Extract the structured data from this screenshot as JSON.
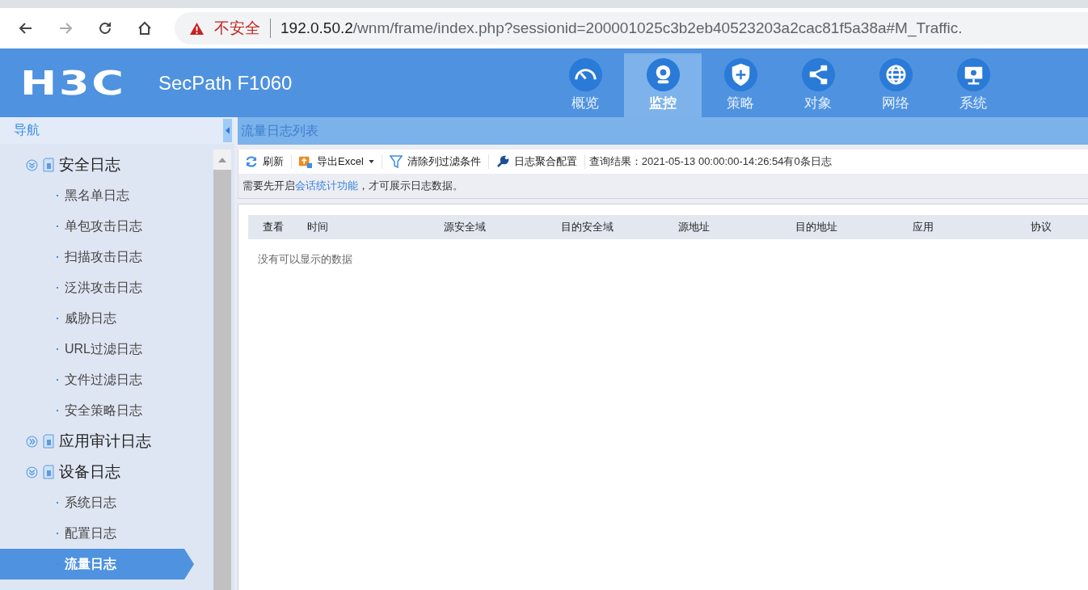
{
  "browser": {
    "security_label": "不安全",
    "url_host": "192.0.50.2",
    "url_path": "/wnm/frame/index.php?sessionid=200001025c3b2eb40523203a2cac81f5a38a#M_Traffic."
  },
  "header": {
    "logo": "H3C",
    "product": "SecPath F1060"
  },
  "nav_tabs": [
    {
      "label": "概览",
      "kind": "gauge",
      "selected": false
    },
    {
      "label": "监控",
      "kind": "camera",
      "selected": true
    },
    {
      "label": "策略",
      "kind": "shield",
      "selected": false
    },
    {
      "label": "对象",
      "kind": "share",
      "selected": false
    },
    {
      "label": "网络",
      "kind": "globe",
      "selected": false
    },
    {
      "label": "系统",
      "kind": "monitor",
      "selected": false
    }
  ],
  "sidebar": {
    "title": "导航",
    "items": [
      {
        "label": "安全日志",
        "expanded": true,
        "children": [
          {
            "label": "黑名单日志",
            "selected": false
          },
          {
            "label": "单包攻击日志",
            "selected": false
          },
          {
            "label": "扫描攻击日志",
            "selected": false
          },
          {
            "label": "泛洪攻击日志",
            "selected": false
          },
          {
            "label": "威胁日志",
            "selected": false
          },
          {
            "label": "URL过滤日志",
            "selected": false
          },
          {
            "label": "文件过滤日志",
            "selected": false
          },
          {
            "label": "安全策略日志",
            "selected": false
          }
        ]
      },
      {
        "label": "应用审计日志",
        "expanded": false
      },
      {
        "label": "设备日志",
        "expanded": true,
        "children": [
          {
            "label": "系统日志",
            "selected": false
          },
          {
            "label": "配置日志",
            "selected": false
          },
          {
            "label": "流量日志",
            "selected": true
          }
        ]
      }
    ]
  },
  "panel": {
    "title": "流量日志列表",
    "toolbar": [
      {
        "label": "刷新",
        "kind": "refresh"
      },
      {
        "label": "导出Excel",
        "kind": "export"
      },
      {
        "label": "清除列过滤条件",
        "kind": "filter"
      },
      {
        "label": "日志聚合配置",
        "kind": "wrench"
      }
    ],
    "query_result": "查询结果：2021-05-13 00:00:00-14:26:54有0条日志",
    "notice": {
      "before": "需要先开启",
      "link": "会话统计功能",
      "after": "，才可展示日志数据。"
    },
    "table": {
      "columns": [
        "查看",
        "时间",
        "源安全域",
        "目的安全域",
        "源地址",
        "目的地址",
        "应用",
        "协议"
      ],
      "empty_text": "没有可以显示的数据"
    }
  }
}
